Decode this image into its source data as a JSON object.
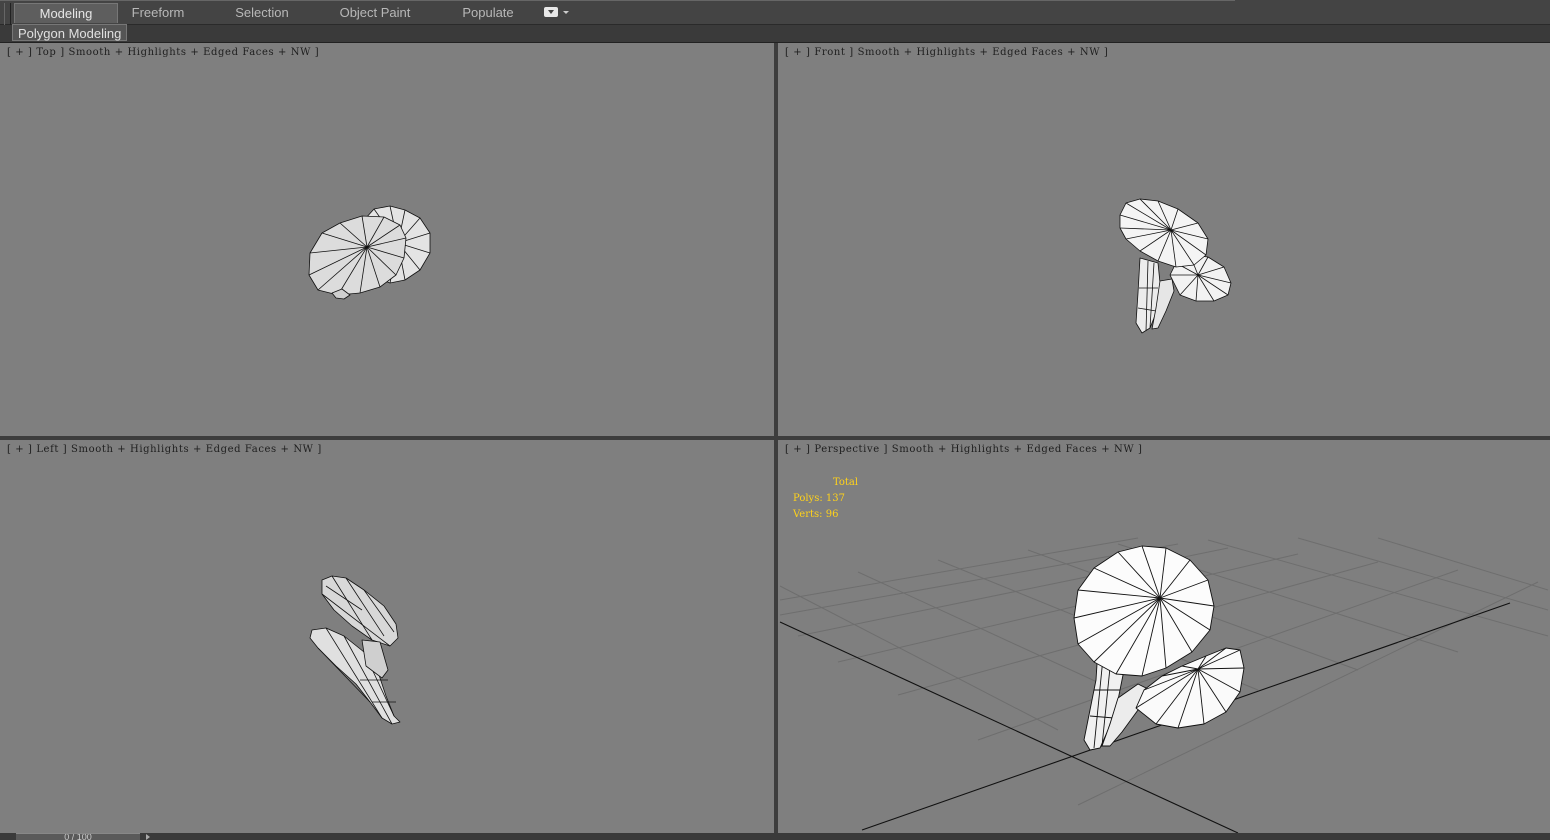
{
  "ribbon": {
    "tabs": [
      {
        "label": "Modeling",
        "active": true
      },
      {
        "label": "Freeform",
        "active": false
      },
      {
        "label": "Selection",
        "active": false
      },
      {
        "label": "Object Paint",
        "active": false
      },
      {
        "label": "Populate",
        "active": false
      }
    ],
    "panel_label": "Polygon Modeling",
    "dropdown_icon": "dropdown-box-icon"
  },
  "viewports": {
    "top": {
      "label": "[ + ] Top ] Smooth + Highlights + Edged Faces + NW ]"
    },
    "front": {
      "label": "[ + ] Front ] Smooth + Highlights + Edged Faces + NW ]"
    },
    "left": {
      "label": "[ + ] Left ] Smooth + Highlights + Edged Faces + NW ]"
    },
    "perspective": {
      "label": "[ + ] Perspective ] Smooth + Highlights + Edged Faces + NW ]",
      "stats": {
        "header": "Total",
        "polys": "Polys: 137",
        "verts": "Verts: 96"
      }
    }
  },
  "statusbar": {
    "frame": "0 / 100"
  },
  "colors": {
    "viewport_bg": "#7f7f7f",
    "stats_text": "#ffd21a",
    "ui_bg": "#3d3d3d",
    "mesh_fill": "#f2f2f2",
    "mesh_edge": "#000000"
  }
}
